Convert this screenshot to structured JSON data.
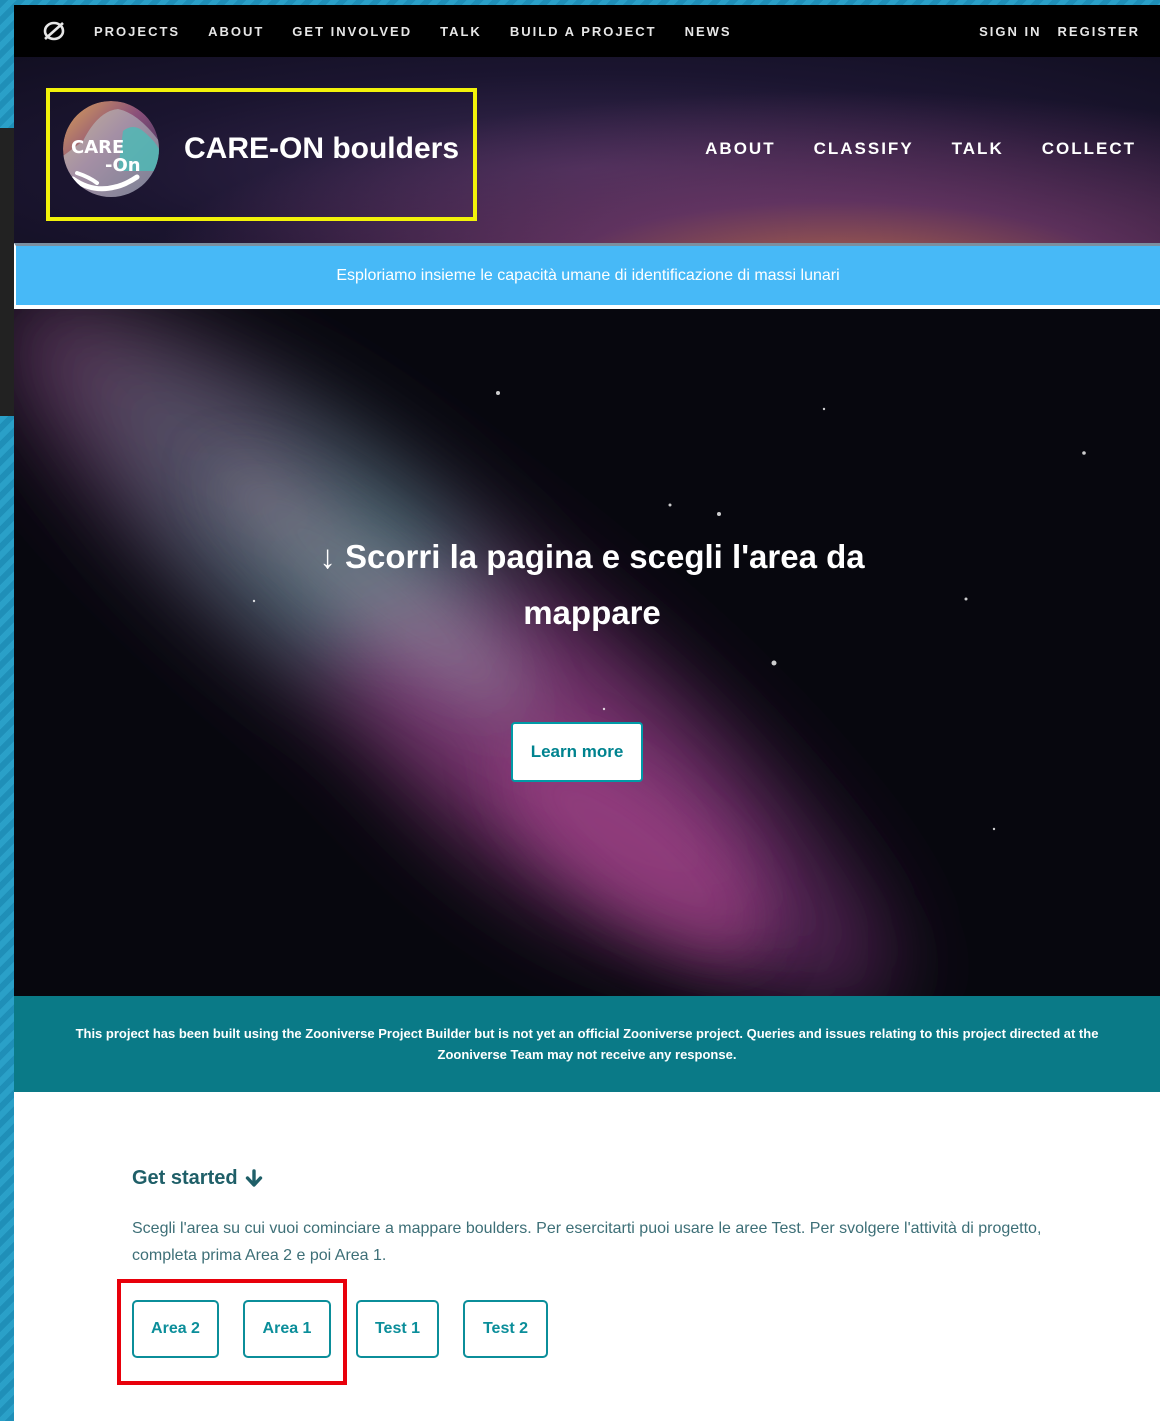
{
  "zooniverse_nav": {
    "links": [
      "PROJECTS",
      "ABOUT",
      "GET INVOLVED",
      "TALK",
      "BUILD A PROJECT",
      "NEWS"
    ],
    "sign_in": "SIGN IN",
    "register": "REGISTER"
  },
  "project": {
    "title": "CARE-ON boulders",
    "avatar_text_1": "CARE",
    "avatar_text_2": "-On",
    "nav": [
      "ABOUT",
      "CLASSIFY",
      "TALK",
      "COLLECT"
    ]
  },
  "announcement": "Esploriamo insieme le capacità umane di identificazione di massi lunari",
  "hero": {
    "title_line1": "↓ Scorri la pagina e scegli l'area da",
    "title_line2": "mappare",
    "learn_more": "Learn more"
  },
  "disclaimer": "This project has been built using the Zooniverse Project Builder but is not yet an official Zooniverse project. Queries and issues relating to this project directed at the Zooniverse Team may not receive any response.",
  "get_started": {
    "title": "Get started",
    "description": "Scegli l'area su cui vuoi cominciare a mappare boulders. Per esercitarti puoi usare le aree Test. Per svolgere l'attività di progetto, completa prima Area 2 e poi Area 1.",
    "workflows": [
      "Area 2",
      "Area 1",
      "Test 1",
      "Test 2"
    ]
  },
  "colors": {
    "announcement_bg": "#47b9f7",
    "teal": "#0a7a87",
    "highlight_yellow": "#f2f20a",
    "highlight_red": "#e8000b"
  }
}
